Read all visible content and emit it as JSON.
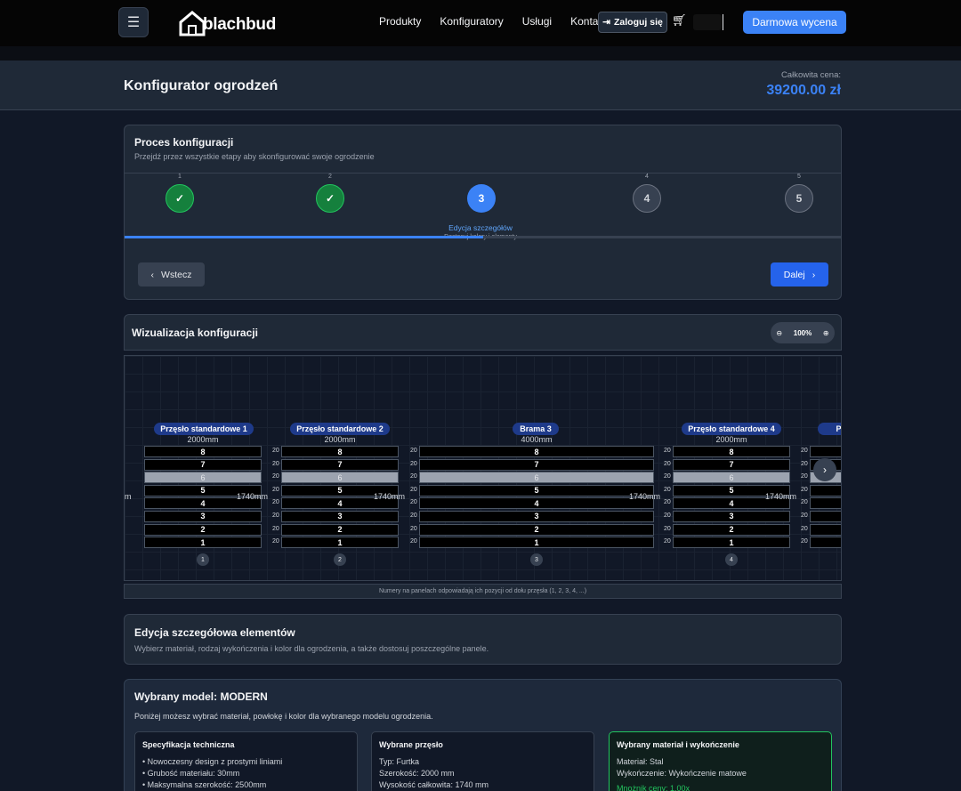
{
  "nav": {
    "brand": "blachbud",
    "links": [
      "Produkty",
      "Konfiguratory",
      "Usługi",
      "Kontakt"
    ],
    "login": "Zaloguj się",
    "cta": "Darmowa wycena"
  },
  "header": {
    "title": "Konfigurator ogrodzeń",
    "price_label": "Całkowita cena:",
    "price": "39200.00 zł"
  },
  "process": {
    "title": "Proces konfiguracji",
    "subtitle": "Przejdź przez wszystkie etapy aby skonfigurować swoje ogrodzenie",
    "steps": [
      {
        "num": "1",
        "state": "done",
        "icon": "check-icon"
      },
      {
        "num": "2",
        "state": "done",
        "icon": "check-icon"
      },
      {
        "num": "3",
        "state": "active",
        "label": "3"
      },
      {
        "num": "4",
        "state": "todo",
        "label": "4"
      },
      {
        "num": "5",
        "state": "todo",
        "label": "5"
      }
    ],
    "active_label": "Edycja szczegółów",
    "active_sub": "Dostosuj kolory i elementy",
    "progress": 0.5,
    "back": "Wstecz",
    "next": "Dalej"
  },
  "viz": {
    "title": "Wizualizacja konfiguracji",
    "zoom": "100%",
    "sections": [
      {
        "name": "Przęsło standardowe 1",
        "width": "2000mm",
        "pos": "1"
      },
      {
        "name": "Przęsło standardowe 2",
        "width": "2000mm",
        "pos": "2"
      },
      {
        "name": "Brama 3",
        "width": "4000mm",
        "pos": "3"
      },
      {
        "name": "Przęsło standardowe 4",
        "width": "2000mm",
        "pos": "4"
      },
      {
        "name": "Prze",
        "width": "",
        "pos": ""
      }
    ],
    "panels": [
      "8",
      "7",
      "6",
      "5",
      "4",
      "3",
      "2",
      "1"
    ],
    "selected_panel": "6",
    "height": "1740mm",
    "height_cut": "m",
    "gap": "20",
    "note": "Numery na panelach odpowiadają ich pozycji od dołu przęsła (1, 2, 3, 4, ...)"
  },
  "edit": {
    "title": "Edycja szczegółowa elementów",
    "subtitle": "Wybierz materiał, rodzaj wykończenia i kolor dla ogrodzenia, a także dostosuj poszczególne panele."
  },
  "model": {
    "title": "Wybrany model: MODERN",
    "subtitle": "Poniżej możesz wybrać materiał, powłokę i kolor dla wybranego modelu ogrodzenia.",
    "spec": {
      "title": "Specyfikacja techniczna",
      "items": [
        "• Nowoczesny design z prostymi liniami",
        "• Grubość materiału: 30mm",
        "• Maksymalna szerokość: 2500mm"
      ]
    },
    "span": {
      "title": "Wybrane przęsło",
      "items": [
        "Typ: Furtka",
        "Szerokość: 2000 mm",
        "Wysokość całkowita: 1740 mm"
      ]
    },
    "material": {
      "title": "Wybrany materiał i wykończenie",
      "items": [
        "Materiał: Stal",
        "Wykończenie: Wykończenie matowe"
      ],
      "multiplier": "Mnożnik ceny: 1.00x"
    }
  }
}
